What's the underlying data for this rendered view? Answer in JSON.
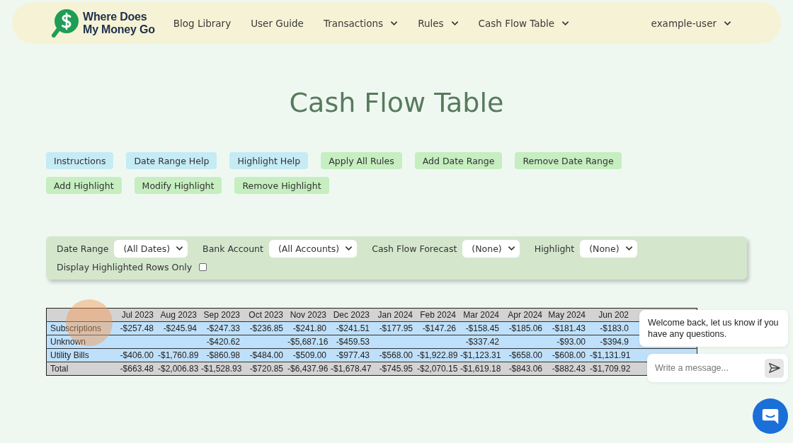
{
  "header": {
    "logo": {
      "line1": "Where Does",
      "line2": "My Money Go"
    },
    "nav": [
      {
        "label": "Blog Library",
        "dropdown": false
      },
      {
        "label": "User Guide",
        "dropdown": false
      },
      {
        "label": "Transactions",
        "dropdown": true
      },
      {
        "label": "Rules",
        "dropdown": true
      },
      {
        "label": "Cash Flow Table",
        "dropdown": true
      }
    ],
    "user": {
      "label": "example-user",
      "dropdown": true
    }
  },
  "title": "Cash Flow Table",
  "buttons": [
    {
      "label": "Instructions",
      "kind": "help"
    },
    {
      "label": "Date Range Help",
      "kind": "help"
    },
    {
      "label": "Highlight Help",
      "kind": "help"
    },
    {
      "label": "Apply All Rules",
      "kind": "action"
    },
    {
      "label": "Add Date Range",
      "kind": "action"
    },
    {
      "label": "Remove Date Range",
      "kind": "action"
    },
    {
      "label": "Add Highlight",
      "kind": "action"
    },
    {
      "label": "Modify Highlight",
      "kind": "action"
    },
    {
      "label": "Remove Highlight",
      "kind": "action"
    }
  ],
  "filters": {
    "selects": [
      {
        "label": "Date Range",
        "value": "(All Dates)"
      },
      {
        "label": "Bank Account",
        "value": "(All Accounts)"
      },
      {
        "label": "Cash Flow Forecast",
        "value": "(None)"
      },
      {
        "label": "Highlight",
        "value": "(None)"
      }
    ],
    "checkbox": {
      "label": "Display Highlighted Rows Only",
      "checked": false
    }
  },
  "table": {
    "columns": [
      "Jul 2023",
      "Aug 2023",
      "Sep 2023",
      "Oct 2023",
      "Nov 2023",
      "Dec 2023",
      "Jan 2024",
      "Feb 2024",
      "Mar 2024",
      "Apr 2024",
      "May 2024",
      "Jun 202"
    ],
    "rows": [
      {
        "label": "Subscriptions",
        "kind": "category",
        "cells": [
          "-$257.48",
          "-$245.94",
          "-$247.33",
          "-$236.85",
          "-$241.80",
          "-$241.51",
          "-$177.95",
          "-$147.26",
          "-$158.45",
          "-$185.06",
          "-$181.43",
          "-$183.0"
        ]
      },
      {
        "label": "Unknown",
        "kind": "category",
        "cells": [
          null,
          null,
          "-$420.62",
          null,
          "-$5,687.16",
          "-$459.53",
          null,
          null,
          "-$337.42",
          null,
          "-$93.00",
          "-$394.9"
        ]
      },
      {
        "label": "Utility Bills",
        "kind": "category",
        "cells": [
          "-$406.00",
          "-$1,760.89",
          "-$860.98",
          "-$484.00",
          "-$509.00",
          "-$977.43",
          "-$568.00",
          "-$1,922.89",
          "-$1,123.31",
          "-$658.00",
          "-$608.00",
          "-$1,131.91"
        ]
      },
      {
        "label": "Total",
        "kind": "total",
        "cells": [
          "-$663.48",
          "-$2,006.83",
          "-$1,528.93",
          "-$720.85",
          "-$6,437.96",
          "-$1,678.47",
          "-$745.95",
          "-$2,070.15",
          "-$1,619.18",
          "-$843.06",
          "-$882.43",
          "-$1,709.92"
        ]
      }
    ]
  },
  "chat": {
    "message": "Welcome back, let us know if you have any questions.",
    "input": {
      "placeholder": "Write a message..."
    }
  }
}
